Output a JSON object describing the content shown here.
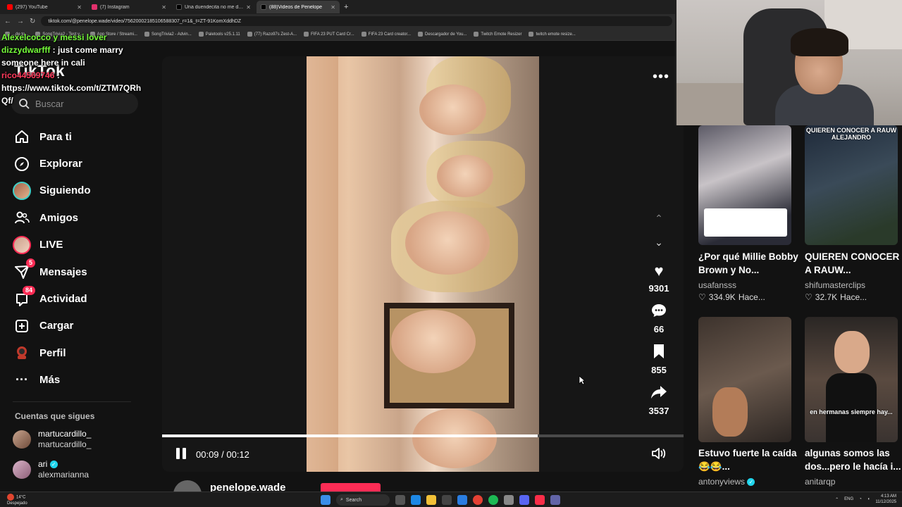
{
  "browser": {
    "tabs": [
      {
        "title": "(297) YouTube",
        "color": "#ff0000",
        "active": false
      },
      {
        "title": "(7) Instagram",
        "color": "#e1306c",
        "active": false
      },
      {
        "title": "Una duendecita no me deja gr...",
        "color": "#000000",
        "active": false
      },
      {
        "title": "(88)Videos de Penelope",
        "color": "#000000",
        "active": true
      }
    ],
    "url": "tiktok.com/@penelope.wade/video/75620002185106588307_r=1&_t=ZT-91KomXddhDZ",
    "bookmarks": [
      "...de to...",
      "SongTrivia2 - Test y...",
      "App Store / Streami...",
      "SongTrivia2 - Advin...",
      "Paletools v25.1.11",
      "(77) Razo97s Zest-A...",
      "FIFA 23 PUT Card Cr...",
      "FIFA 23 Card creator...",
      "Descargador de You...",
      "Twitch Emote Resizer",
      "twitch emote resize..."
    ]
  },
  "chat": [
    {
      "user": "Alexelcocco y messi lover",
      "text": "",
      "color": "#76ff3a"
    },
    {
      "user": "dizzydwarfff",
      "text": "just come marry someone here in cali",
      "color": "#76ff3a"
    },
    {
      "user": "rico44569746",
      "text": "https://www.tiktok.com/t/ZTM7QRhQf/",
      "color": "#ff3a5c"
    }
  ],
  "sidebar": {
    "logo": "TikTok",
    "search_placeholder": "Buscar",
    "items": [
      {
        "label": "Para ti",
        "icon": "home-icon"
      },
      {
        "label": "Explorar",
        "icon": "compass-icon"
      },
      {
        "label": "Siguiendo",
        "icon": "following-avatar-icon"
      },
      {
        "label": "Amigos",
        "icon": "friends-icon"
      },
      {
        "label": "LIVE",
        "icon": "live-avatar-icon"
      },
      {
        "label": "Mensajes",
        "icon": "messages-icon",
        "badge": "5"
      },
      {
        "label": "Actividad",
        "icon": "activity-icon",
        "badge": "84"
      },
      {
        "label": "Cargar",
        "icon": "upload-icon"
      },
      {
        "label": "Perfil",
        "icon": "profile-icon"
      },
      {
        "label": "Más",
        "icon": "more-icon"
      }
    ],
    "following_heading": "Cuentas que sigues",
    "accounts": [
      {
        "display": "martucardillo_",
        "handle": "martucardillo_",
        "verified": false
      },
      {
        "display": "ari",
        "handle": "alexmarianna",
        "verified": true
      }
    ]
  },
  "player": {
    "likes": "9301",
    "comments": "66",
    "saves": "855",
    "shares": "3537",
    "time": "00:09 / 00:12",
    "progress": 0.72,
    "author": "penelope.wade"
  },
  "recommendations": [
    {
      "title": "¿Por qué Millie Bobby Brown y No...",
      "author": "usafansss",
      "likes": "334.9K",
      "time": "Hace...",
      "caption": "",
      "verified": false
    },
    {
      "title": "QUIEREN CONOCER A RAUW...",
      "author": "shifumasterclips",
      "likes": "32.7K",
      "time": "Hace...",
      "caption": "QUIEREN CONOCER A RAUW ALEJANDRO",
      "verified": false
    },
    {
      "title": "Estuvo fuerte la caída 😂😂...",
      "author": "antonyviews",
      "likes": "",
      "time": "",
      "caption": "",
      "verified": true
    },
    {
      "title": "algunas somos las dos...pero le hacía i...",
      "author": "anitarqp",
      "likes": "",
      "time": "",
      "caption": "en hermanas siempre hay...",
      "verified": false
    }
  ],
  "taskbar": {
    "weather_temp": "14°C",
    "weather_desc": "Despejado",
    "search": "Search",
    "lang": "ENG",
    "time": "4:13 AM",
    "date": "11/12/2025"
  }
}
